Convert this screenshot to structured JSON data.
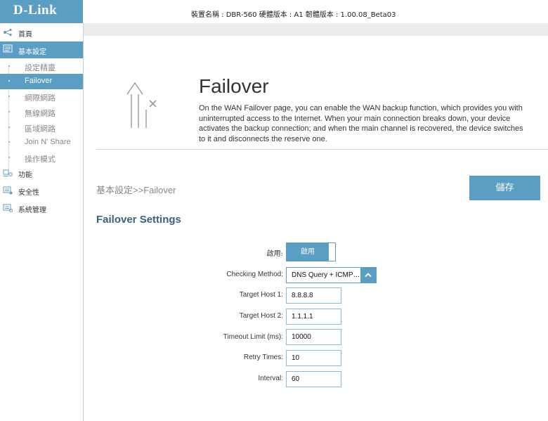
{
  "header": {
    "logo": "D-Link",
    "device_info": "裝置名稱 : DBR-560 硬體版本 : A1 韌體版本 : 1.00.08_Beta03"
  },
  "sidebar": {
    "items": [
      {
        "label": "首頁",
        "icon": "network-home-icon"
      },
      {
        "label": "基本設定",
        "icon": "settings-list-icon"
      },
      {
        "label": "功能",
        "icon": "features-icon"
      },
      {
        "label": "安全性",
        "icon": "security-icon"
      },
      {
        "label": "系統管理",
        "icon": "system-management-icon"
      }
    ],
    "subitems": [
      "設定精靈",
      "Failover",
      "網際網路",
      "無線網路",
      "區域網路",
      "Join N' Share",
      "操作模式"
    ]
  },
  "main": {
    "title": "Failover",
    "description": "On the WAN Failover page, you can enable the WAN backup function, which provides you with uninterrupted access to the Internet. When your main connection breaks down, your device activates the backup connection; and when the main channel is recovered, the device switches to it and disconnects the reserve one.",
    "breadcrumb_zh": "基本設定",
    "breadcrumb_en": ">>Failover",
    "save_label": "儲存",
    "section_title": "Failover Settings"
  },
  "form": {
    "enable_label": "啟用:",
    "enable_value": "啟用",
    "checking_method_label": "Checking Method:",
    "checking_method_value": "DNS Query + ICMP…",
    "target_host1_label": "Target Host 1:",
    "target_host1_value": "8.8.8.8",
    "target_host2_label": "Target Host 2:",
    "target_host2_value": "1.1.1.1",
    "timeout_label": "Timeout Limit (ms):",
    "timeout_value": "10000",
    "retry_label": "Retry Times:",
    "retry_value": "10",
    "interval_label": "Interval:",
    "interval_value": "60"
  },
  "colors": {
    "accent": "#5b9ec4",
    "section_title": "#39617e"
  }
}
